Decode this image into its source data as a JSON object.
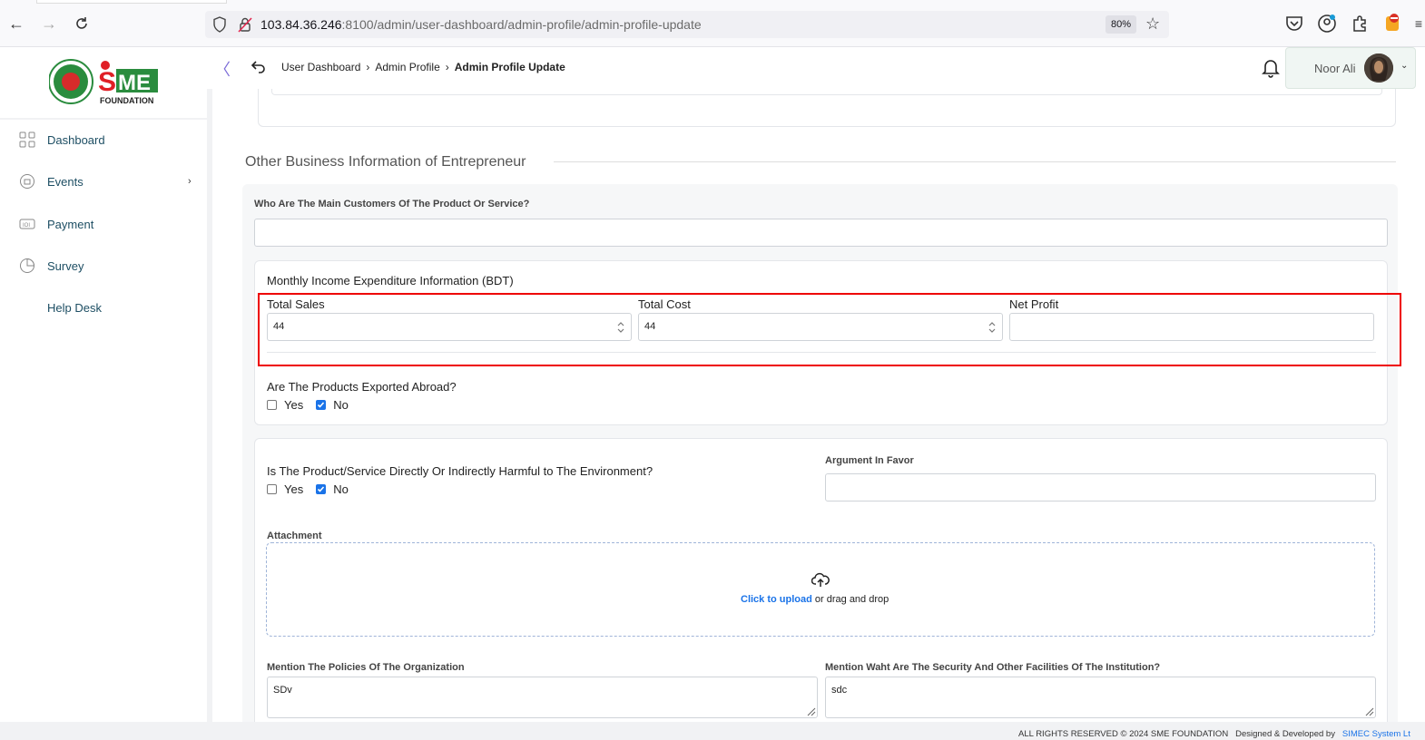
{
  "browser": {
    "url_host": "103.84.36.246",
    "url_rest": ":8100/admin/user-dashboard/admin-profile/admin-profile-update",
    "zoom": "80%"
  },
  "sidebar": {
    "brand": "FOUNDATION",
    "items": [
      {
        "label": "Dashboard",
        "icon": "grid-icon"
      },
      {
        "label": "Events",
        "icon": "events-icon"
      },
      {
        "label": "Payment",
        "icon": "payment-icon"
      },
      {
        "label": "Survey",
        "icon": "survey-icon"
      },
      {
        "label": "Help Desk",
        "icon": ""
      }
    ]
  },
  "header": {
    "breadcrumb": [
      "User Dashboard",
      "Admin Profile",
      "Admin Profile Update"
    ],
    "user_name": "Noor Ali"
  },
  "form": {
    "section_title": "Other Business Information of Entrepreneur",
    "customers_label": "Who Are The Main Customers Of The Product Or Service?",
    "customers_value": "",
    "monthly_title": "Monthly Income Expenditure Information (BDT)",
    "total_sales_label": "Total Sales",
    "total_sales_value": "44",
    "total_cost_label": "Total Cost",
    "total_cost_value": "44",
    "net_profit_label": "Net Profit",
    "net_profit_value": "",
    "export_question": "Are The Products Exported Abroad?",
    "export_yes": "Yes",
    "export_no": "No",
    "export_selected": "No",
    "env_question": "Is The Product/Service Directly Or Indirectly Harmful to The Environment?",
    "env_yes": "Yes",
    "env_no": "No",
    "env_selected": "No",
    "argument_label": "Argument In Favor",
    "argument_value": "",
    "attachment_label": "Attachment",
    "upload_link": "Click to upload",
    "upload_rest": "or drag and drop",
    "policies_label": "Mention The Policies Of The Organization",
    "policies_value": "SDv",
    "security_label": "Mention Waht Are The Security And Other Facilities Of The Institution?",
    "security_value": "sdc"
  },
  "footer": {
    "rights": "ALL RIGHTS RESERVED © 2024 SME FOUNDATION",
    "designed": "Designed & Developed by",
    "company": "SIMEC System Lt"
  },
  "colors": {
    "accent": "#1a73e8",
    "highlight": "#ee0000",
    "sidebar_text": "#1d4e63"
  }
}
